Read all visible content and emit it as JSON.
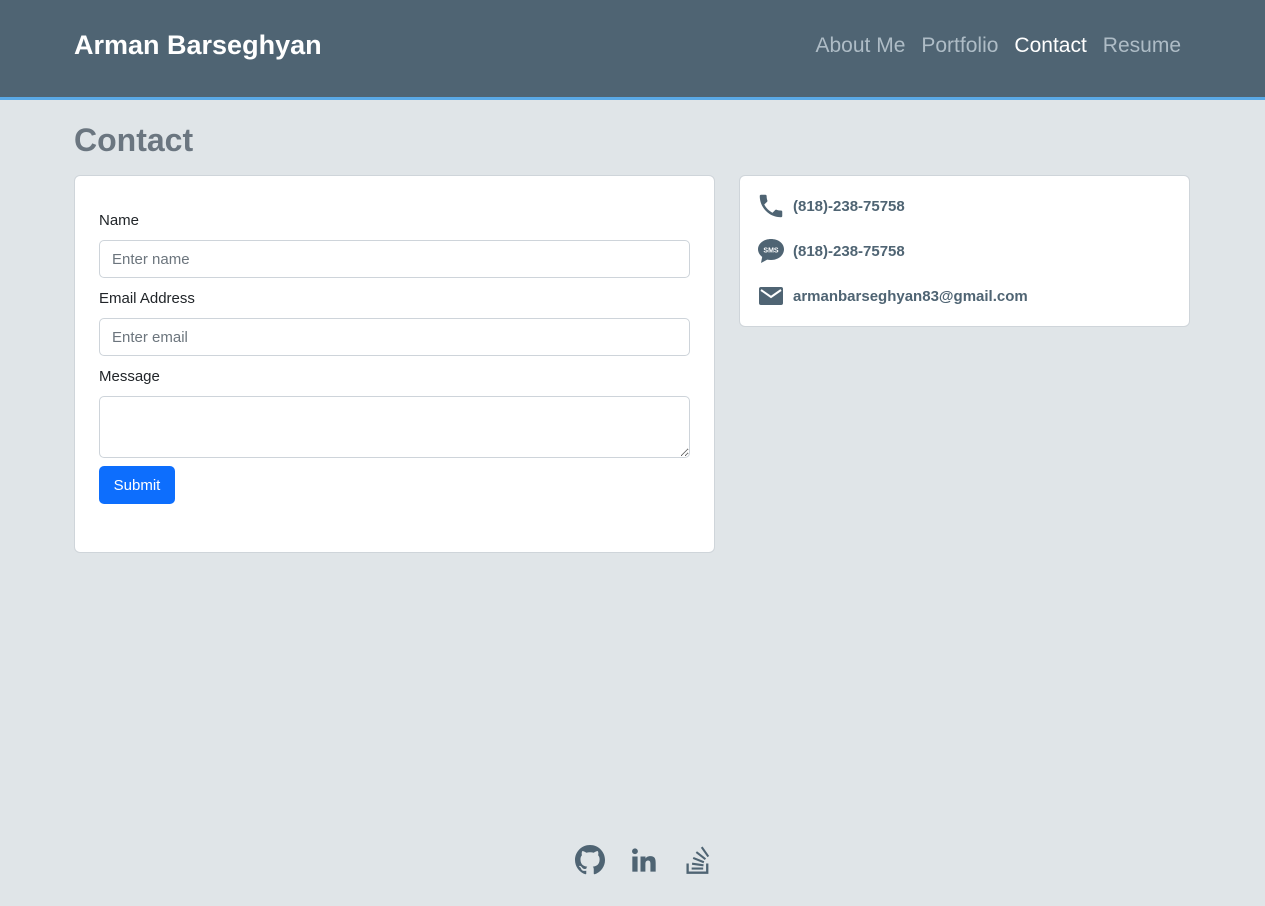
{
  "navbar": {
    "brand": "Arman Barseghyan",
    "links": [
      {
        "label": "About Me",
        "active": false
      },
      {
        "label": "Portfolio",
        "active": false
      },
      {
        "label": "Contact",
        "active": true
      },
      {
        "label": "Resume",
        "active": false
      }
    ]
  },
  "page": {
    "title": "Contact"
  },
  "form": {
    "name_label": "Name",
    "name_placeholder": "Enter name",
    "email_label": "Email Address",
    "email_placeholder": "Enter email",
    "message_label": "Message",
    "submit_label": "Submit"
  },
  "contact_info": {
    "phone": "(818)-238-75758",
    "sms": "(818)-238-75758",
    "email": "armanbarseghyan83@gmail.com"
  },
  "icons": {
    "phone": "phone-icon",
    "sms": "sms-icon",
    "email": "envelope-icon",
    "github": "github-icon",
    "linkedin": "linkedin-icon",
    "stackoverflow": "stackoverflow-icon"
  },
  "colors": {
    "navbar": "#4f6473",
    "accent": "#5aa9e6",
    "background": "#e0e5e8",
    "button": "#0d6efd",
    "icon": "#4f6473"
  }
}
